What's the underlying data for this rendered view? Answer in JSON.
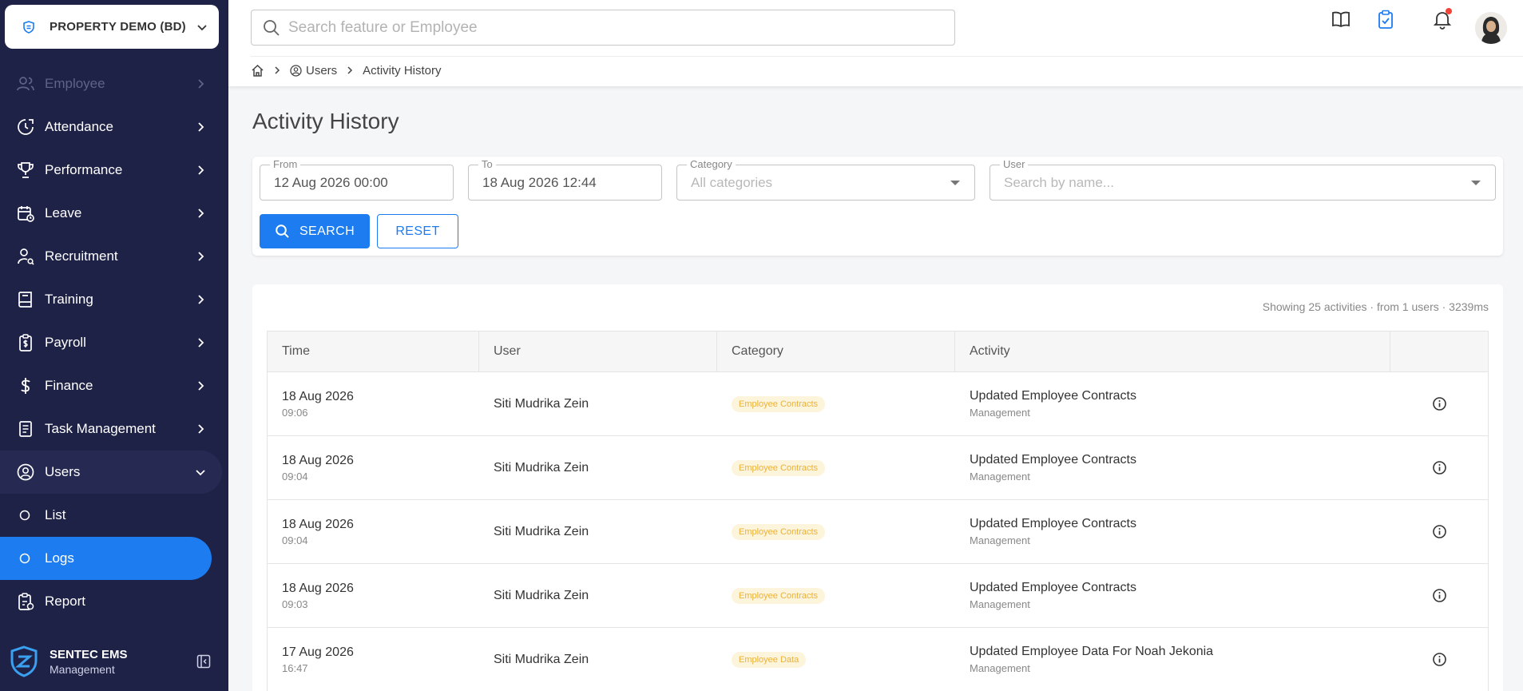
{
  "org": {
    "name": "PROPERTY DEMO (BD)"
  },
  "sidebar": {
    "items": [
      {
        "label": "Employee"
      },
      {
        "label": "Attendance"
      },
      {
        "label": "Performance"
      },
      {
        "label": "Leave"
      },
      {
        "label": "Recruitment"
      },
      {
        "label": "Training"
      },
      {
        "label": "Payroll"
      },
      {
        "label": "Finance"
      },
      {
        "label": "Task Management"
      },
      {
        "label": "Users"
      },
      {
        "label": "List"
      },
      {
        "label": "Logs"
      },
      {
        "label": "Report"
      }
    ],
    "brand_name": "SENTEC EMS",
    "brand_sub": "Management"
  },
  "search": {
    "placeholder": "Search feature or Employee"
  },
  "breadcrumb": {
    "users": "Users",
    "current": "Activity History"
  },
  "page": {
    "title": "Activity History"
  },
  "filters": {
    "from_label": "From",
    "from_value": "12 Aug 2026 00:00",
    "to_label": "To",
    "to_value": "18 Aug 2026 12:44",
    "category_label": "Category",
    "category_placeholder": "All categories",
    "user_label": "User",
    "user_placeholder": "Search by name...",
    "search_button": "SEARCH",
    "reset_button": "RESET"
  },
  "summary": "Showing 25 activities · from 1 users · 3239ms",
  "table": {
    "headers": [
      "Time",
      "User",
      "Category",
      "Activity",
      ""
    ],
    "rows": [
      {
        "date": "18 Aug 2026",
        "time": "09:06",
        "user": "Siti Mudrika Zein",
        "category": "Employee Contracts",
        "activity": "Updated Employee Contracts",
        "sub": "Management"
      },
      {
        "date": "18 Aug 2026",
        "time": "09:04",
        "user": "Siti Mudrika Zein",
        "category": "Employee Contracts",
        "activity": "Updated Employee Contracts",
        "sub": "Management"
      },
      {
        "date": "18 Aug 2026",
        "time": "09:04",
        "user": "Siti Mudrika Zein",
        "category": "Employee Contracts",
        "activity": "Updated Employee Contracts",
        "sub": "Management"
      },
      {
        "date": "18 Aug 2026",
        "time": "09:03",
        "user": "Siti Mudrika Zein",
        "category": "Employee Contracts",
        "activity": "Updated Employee Contracts",
        "sub": "Management"
      },
      {
        "date": "17 Aug 2026",
        "time": "16:47",
        "user": "Siti Mudrika Zein",
        "category": "Employee Data",
        "activity": "Updated Employee Data For Noah Jekonia",
        "sub": "Management"
      }
    ]
  },
  "colors": {
    "sidebar_bg": "#1f2247",
    "accent": "#1c7cf0",
    "badge_bg": "#fdf4dc",
    "badge_text": "#e8b23c",
    "notification": "#f04438"
  }
}
